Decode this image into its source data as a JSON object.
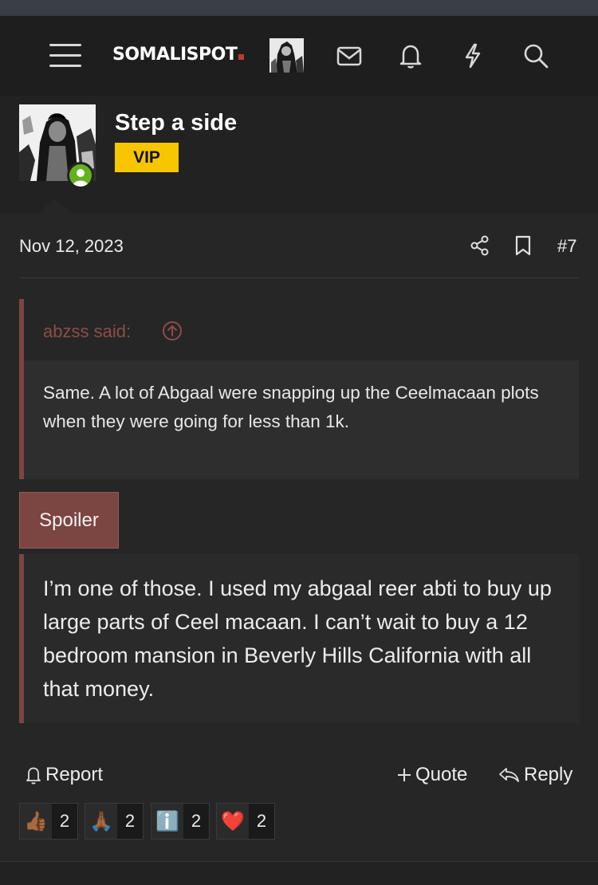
{
  "header": {
    "logo_text": "SOMALISPOT",
    "icons": [
      "menu-icon",
      "inbox-icon",
      "bell-icon",
      "bolt-icon",
      "search-icon"
    ]
  },
  "user": {
    "name": "Step a side",
    "badge": "VIP",
    "badge_color": "#f7c600",
    "online_color": "#63b11f"
  },
  "post": {
    "date": "Nov 12, 2023",
    "number": "#7",
    "quote": {
      "author": "abzss said:",
      "text": "Same. A lot of Abgaal were snapping up the Ceelmacaan plots when they were going for less than 1k."
    },
    "spoiler_label": "Spoiler",
    "spoiler_text": "I’m one of those. I used my abgaal reer abti to buy up large parts of Ceel macaan. I can’t wait to buy a 12 bedroom mansion in Beverly Hills California with all that money.",
    "actions": {
      "report": "Report",
      "quote": "Quote",
      "reply": "Reply"
    },
    "reactions": [
      {
        "emoji": "👍🏾",
        "count": "2",
        "name": "thumbs-up"
      },
      {
        "emoji": "🙏🏾",
        "count": "2",
        "name": "praying-hands"
      },
      {
        "emoji": "ℹ️",
        "count": "2",
        "name": "information"
      },
      {
        "emoji": "❤️",
        "count": "2",
        "name": "red-heart"
      }
    ]
  },
  "colors": {
    "accent_quote": "#7d4542",
    "background": "#222222"
  }
}
